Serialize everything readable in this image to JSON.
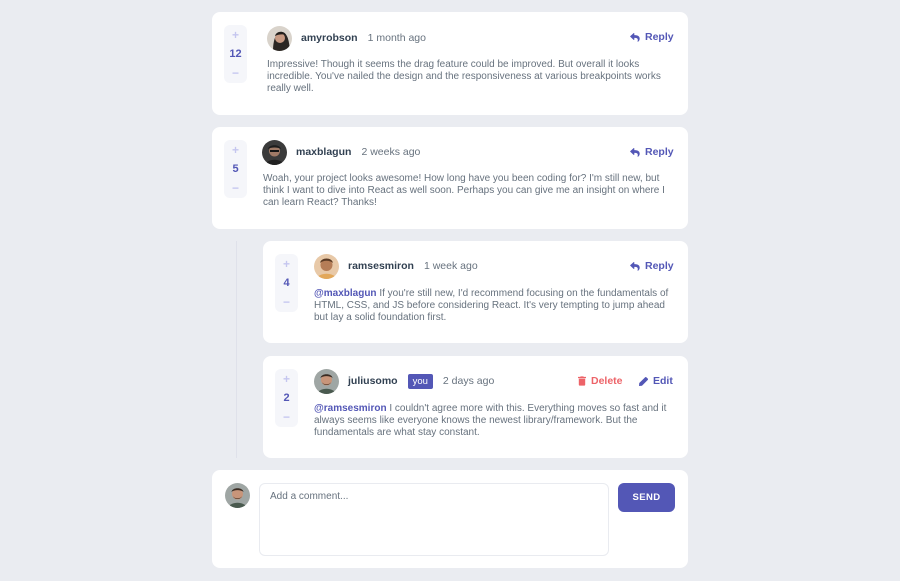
{
  "comments": [
    {
      "score": "12",
      "username": "amyrobson",
      "time": "1 month ago",
      "reply": "Reply",
      "content": "Impressive! Though it seems the drag feature could be improved. But overall it looks incredible. You've nailed the design and the responsiveness at various breakpoints works really well."
    },
    {
      "score": "5",
      "username": "maxblagun",
      "time": "2 weeks ago",
      "reply": "Reply",
      "content": "Woah, your project looks awesome! How long have you been coding for? I'm still new, but think I want to dive into React as well soon. Perhaps you can give me an insight on where I can learn React? Thanks!"
    }
  ],
  "replies": [
    {
      "score": "4",
      "username": "ramsesmiron",
      "time": "1 week ago",
      "reply": "Reply",
      "mention": "@maxblagun",
      "content": " If you're still new, I'd recommend focusing on the fundamentals of HTML, CSS, and JS before considering React. It's very tempting to jump ahead but lay a solid foundation first."
    },
    {
      "score": "2",
      "username": "juliusomo",
      "you": "you",
      "time": "2 days ago",
      "delete": "Delete",
      "edit": "Edit",
      "mention": "@ramsesmiron",
      "content": " I couldn't agree more with this. Everything moves so fast and it always seems like everyone knows the newest library/framework. But the fundamentals are what stay constant."
    }
  ],
  "vote": {
    "plus": "+",
    "minus": "−"
  },
  "new_comment": {
    "placeholder": "Add a comment...",
    "send": "SEND"
  },
  "colors": {
    "accent": "#5357b6",
    "danger": "#ed6368",
    "background": "#eaecf1"
  }
}
